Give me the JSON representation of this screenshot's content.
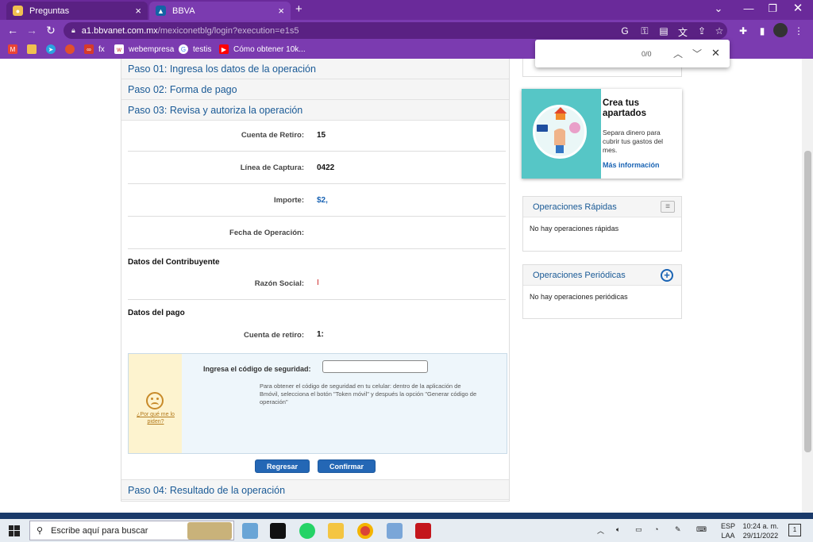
{
  "browser": {
    "tabs": [
      {
        "title": "Preguntas",
        "active": false
      },
      {
        "title": "BBVA",
        "active": true
      }
    ],
    "new_tab": "+",
    "url_host": "a1.bbvanet.com.mx",
    "url_path": "/mexiconetblg/login?execution=e1s5",
    "bookmarks": [
      "fx",
      "webempresa",
      "testis",
      "Cómo obtener 10k..."
    ],
    "find_count": "0/0"
  },
  "steps": {
    "step1": "Paso 01: Ingresa los datos de la operación",
    "step2": "Paso 02: Forma de pago",
    "step3": "Paso 03: Revisa y autoriza la operación",
    "step4": "Paso 04: Resultado de la operación"
  },
  "review": {
    "cuenta_retiro_label": "Cuenta de Retiro:",
    "cuenta_retiro_value": "15",
    "linea_captura_label": "Línea de Captura:",
    "linea_captura_value": "0422",
    "importe_label": "Importe:",
    "importe_value": "$2,",
    "fecha_label": "Fecha de Operación:",
    "contribuyente_title": "Datos del Contribuyente",
    "razon_social_label": "Razón Social:",
    "razon_social_value": "I",
    "pago_title": "Datos del pago",
    "cuenta_retiro2_label": "Cuenta de retiro:",
    "cuenta_retiro2_value": "1:"
  },
  "security": {
    "why_link": "¿Por qué me lo piden?",
    "code_label": "Ingresa el código de seguridad:",
    "help_text": "Para obtener el código de seguridad en tu celular: dentro de la aplicación de Bmóvil, selecciona el botón \"Token móvil\" y después la opción \"Generar código de operación\""
  },
  "buttons": {
    "back": "Regresar",
    "confirm": "Confirmar"
  },
  "promo": {
    "title": "Crea tus apartados",
    "body": "Separa dinero para cubrir tus gastos del mes.",
    "link": "Más información"
  },
  "quick_ops": {
    "title": "Operaciones Rápidas",
    "empty": "No hay operaciones rápidas"
  },
  "periodic_ops": {
    "title": "Operaciones Periódicas",
    "empty": "No hay operaciones periódicas"
  },
  "taskbar": {
    "search_placeholder": "Escribe aquí para buscar",
    "lang1": "ESP",
    "lang2": "LAA",
    "time": "10:24 a. m.",
    "date": "29/11/2022",
    "notif_count": "1"
  },
  "colors": {
    "chrome_purple": "#7b3bb0",
    "bbva_blue": "#1a5a96",
    "button_blue": "#2467b5"
  }
}
